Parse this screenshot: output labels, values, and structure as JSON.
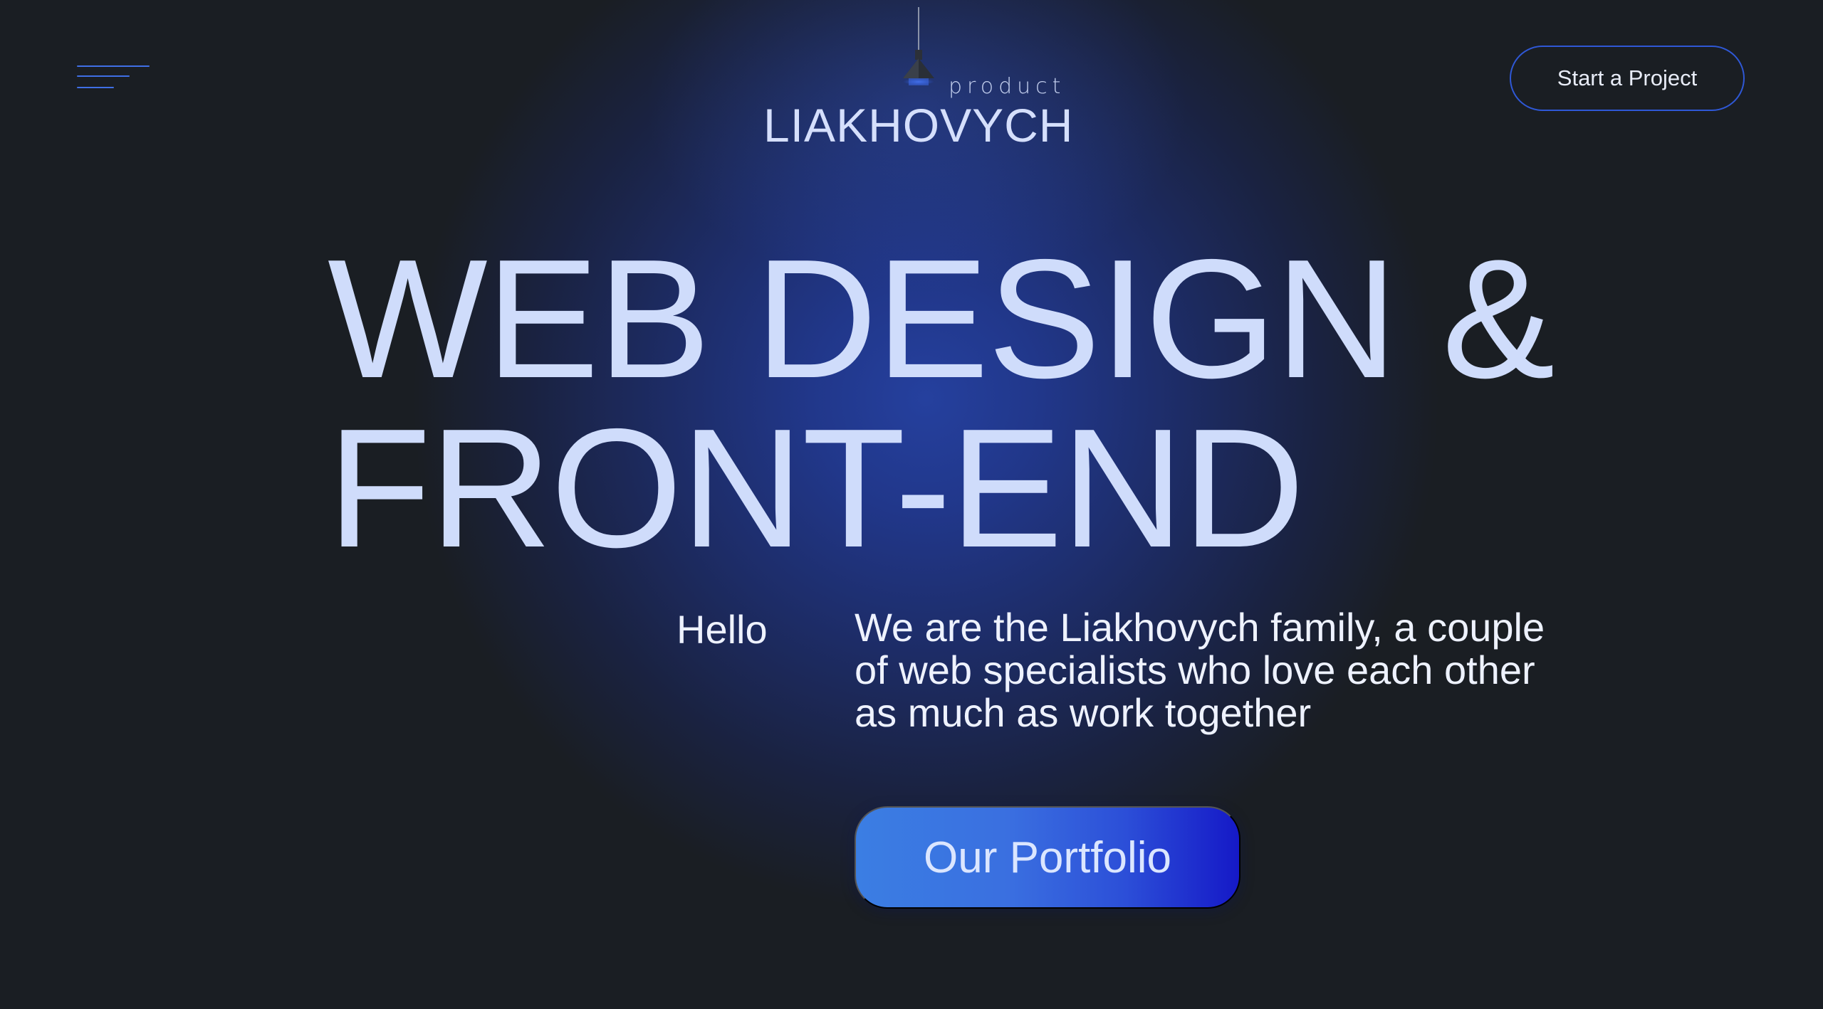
{
  "header": {
    "menu_icon": "hamburger-menu-icon",
    "logo": {
      "product": "product",
      "name": "LIAKHOVYCH",
      "lamp_icon": "pendant-lamp-icon"
    },
    "start_project_label": "Start a Project"
  },
  "hero": {
    "title_line1": "WEB DESIGN &",
    "title_line2": "FRONT-END",
    "hello": "Hello",
    "intro": "We are the Liakhovych family, a couple of web specialists who love each other as much as work together",
    "portfolio_label": "Our Portfolio"
  },
  "colors": {
    "background": "#1a1e23",
    "glow": "#25409e",
    "accent": "#2f58d6",
    "title_text": "#cfdcfb",
    "button_gradient_start": "#3b7ee3",
    "button_gradient_end": "#1519c7"
  }
}
